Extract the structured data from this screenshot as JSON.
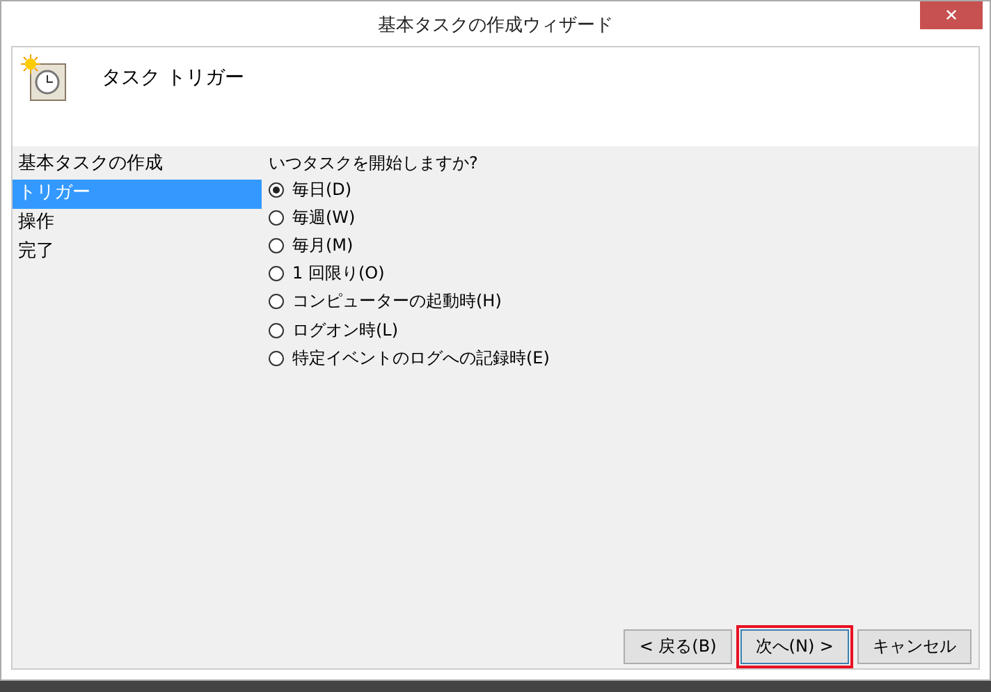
{
  "window": {
    "title": "基本タスクの作成ウィザード",
    "close": "✕"
  },
  "header": {
    "title": "タスク トリガー"
  },
  "steps": [
    {
      "label": "基本タスクの作成",
      "selected": false
    },
    {
      "label": "トリガー",
      "selected": true
    },
    {
      "label": "操作",
      "selected": false
    },
    {
      "label": "完了",
      "selected": false
    }
  ],
  "question": "いつタスクを開始しますか?",
  "options": [
    {
      "label": "毎日(D)",
      "selected": true
    },
    {
      "label": "毎週(W)",
      "selected": false
    },
    {
      "label": "毎月(M)",
      "selected": false
    },
    {
      "label": "1 回限り(O)",
      "selected": false
    },
    {
      "label": "コンピューターの起動時(H)",
      "selected": false
    },
    {
      "label": "ログオン時(L)",
      "selected": false
    },
    {
      "label": "特定イベントのログへの記録時(E)",
      "selected": false
    }
  ],
  "buttons": [
    {
      "label": "< 戻る(B)",
      "highlighted": false
    },
    {
      "label": "次へ(N) >",
      "highlighted": true
    },
    {
      "label": "キャンセル",
      "highlighted": false
    }
  ]
}
